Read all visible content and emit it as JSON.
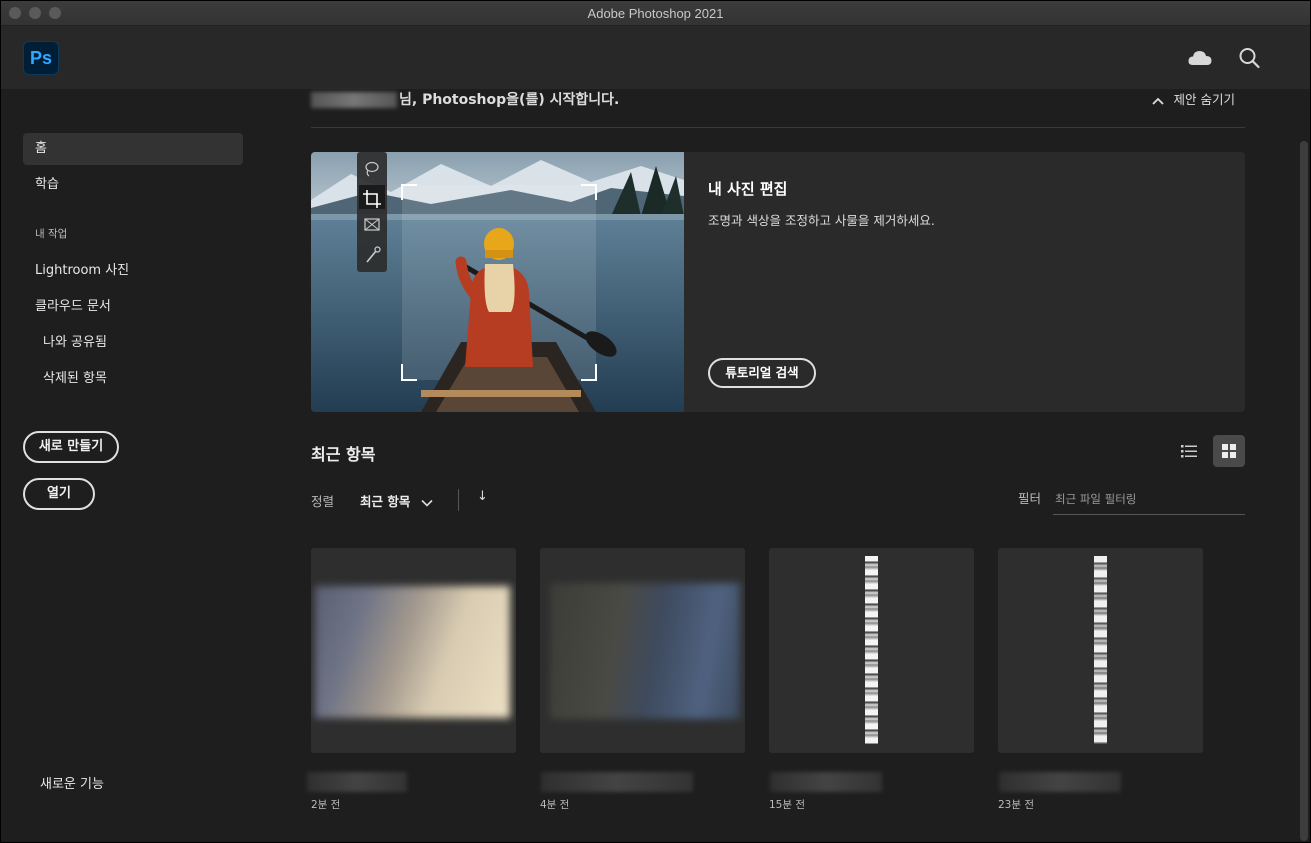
{
  "window": {
    "title": "Adobe Photoshop 2021"
  },
  "header": {
    "logo_text": "Ps",
    "cloud_icon": "cloud-icon",
    "search_icon": "search-icon"
  },
  "sidebar": {
    "items": [
      {
        "label": "홈"
      },
      {
        "label": "학습"
      }
    ],
    "my_work_heading": "내 작업",
    "work_items": [
      {
        "label": "Lightroom 사진"
      },
      {
        "label": "클라우드 문서"
      },
      {
        "label": "나와 공유됨"
      },
      {
        "label": "삭제된 항목"
      }
    ],
    "new_button": "새로 만들기",
    "open_button": "열기",
    "whats_new": "새로운 기능"
  },
  "main": {
    "welcome_text": "님, Photoshop을(를) 시작합니다.",
    "hide_suggestions": "제안 숨기기",
    "feature": {
      "title": "내 사진 편집",
      "description": "조명과 색상을 조정하고 사물을 제거하세요.",
      "button": "튜토리얼 검색"
    },
    "recent": {
      "title": "최근 항목",
      "sort_label": "정렬",
      "sort_value": "최근 항목",
      "sort_direction": "↓",
      "filter_label": "필터",
      "filter_placeholder": "최근 파일 필터링"
    },
    "files": [
      {
        "time": "2분 전"
      },
      {
        "time": "4분 전"
      },
      {
        "time": "15분 전"
      },
      {
        "time": "23분 전"
      }
    ]
  },
  "colors": {
    "ps_blue": "#31a8ff",
    "ps_bg": "#001e36",
    "app_bg": "#1e1e1e",
    "header_bg": "#282828"
  }
}
